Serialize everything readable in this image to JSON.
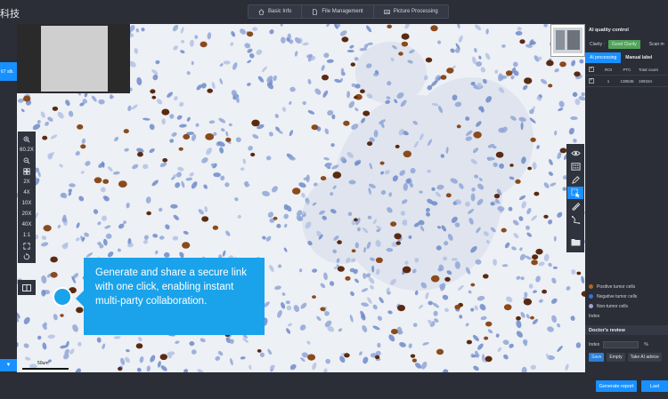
{
  "brand": {
    "title": "科技"
  },
  "nav": {
    "tabs": [
      {
        "label": "Basic Info",
        "icon": "home-icon"
      },
      {
        "label": "File Management",
        "icon": "file-icon"
      },
      {
        "label": "Picture Processing",
        "icon": "image-icon"
      }
    ]
  },
  "left_panel": {
    "tab_label": "67 slb.",
    "bottom_icon": "chevron-down-icon"
  },
  "viewer": {
    "zoom": {
      "current": "60.2X",
      "levels": [
        "2X",
        "4X",
        "10X",
        "20X",
        "40X",
        "1:1"
      ]
    },
    "scale_label": "50um",
    "callout_text": "Generate and share a secure link with one click, enabling instant multi-party collaboration."
  },
  "ai_panel": {
    "title": "AI quality control",
    "clarity_label": "Clarity :",
    "clarity_value": "Good Clarity",
    "scan_label": "Scan m",
    "tabs": [
      "AI processing",
      "Manual label"
    ],
    "table": {
      "headers": [
        "ROI",
        "PTC",
        "Total count"
      ],
      "rows": [
        {
          "roi": "1",
          "ptc": "138536",
          "total": "199334"
        }
      ]
    },
    "legend": [
      {
        "label": "Positive tumor cells",
        "color": "#b5651d"
      },
      {
        "label": "Negative tumor cells",
        "color": "#3b6fd4"
      },
      {
        "label": "Non-tumor cells",
        "color": "#9aa4d8"
      }
    ],
    "index_label": "Index"
  },
  "review": {
    "title": "Doctor's review",
    "index_label": "Index",
    "unit": "%",
    "buttons": [
      "Save",
      "Empty",
      "Take AI advice"
    ]
  },
  "footer": {
    "generate_report": "Generate report",
    "last": "Last"
  },
  "colors": {
    "accent": "#1890ff",
    "callout": "#1aa3ea",
    "good": "#52a35a"
  }
}
